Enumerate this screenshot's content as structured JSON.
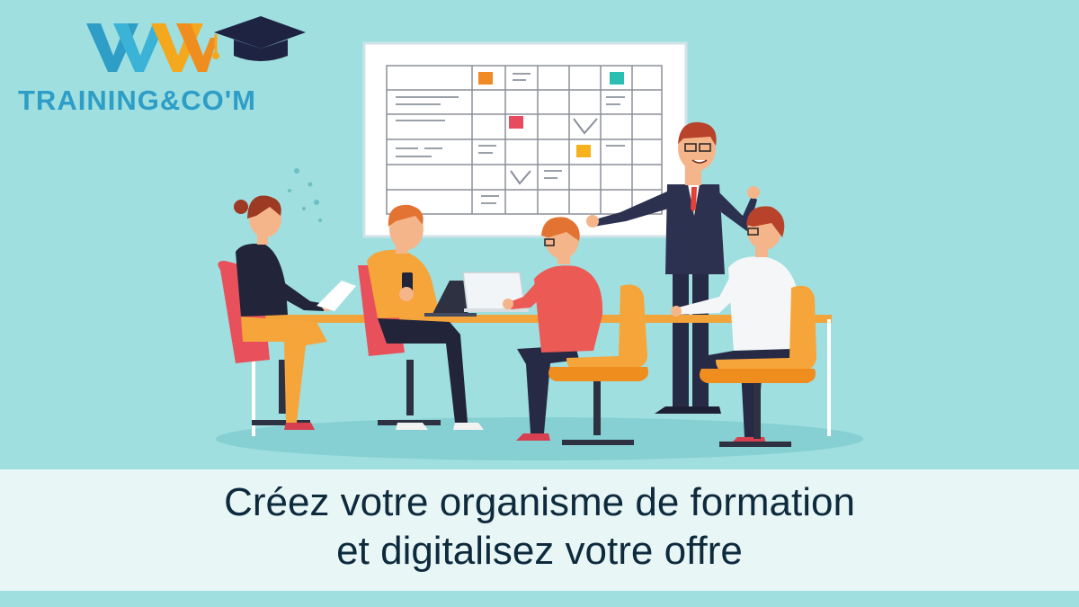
{
  "brand": {
    "name": "TRAINING&CO'M",
    "mark": "WM"
  },
  "headline": {
    "line1": "Créez votre organisme de formation",
    "line2": "et digitalisez votre offre"
  },
  "colors": {
    "background": "#9fdfe0",
    "banner": "#e9f6f6",
    "text": "#0e2a3d",
    "brand_blue": "#2e9ec7",
    "brand_orange": "#f4a81d"
  }
}
